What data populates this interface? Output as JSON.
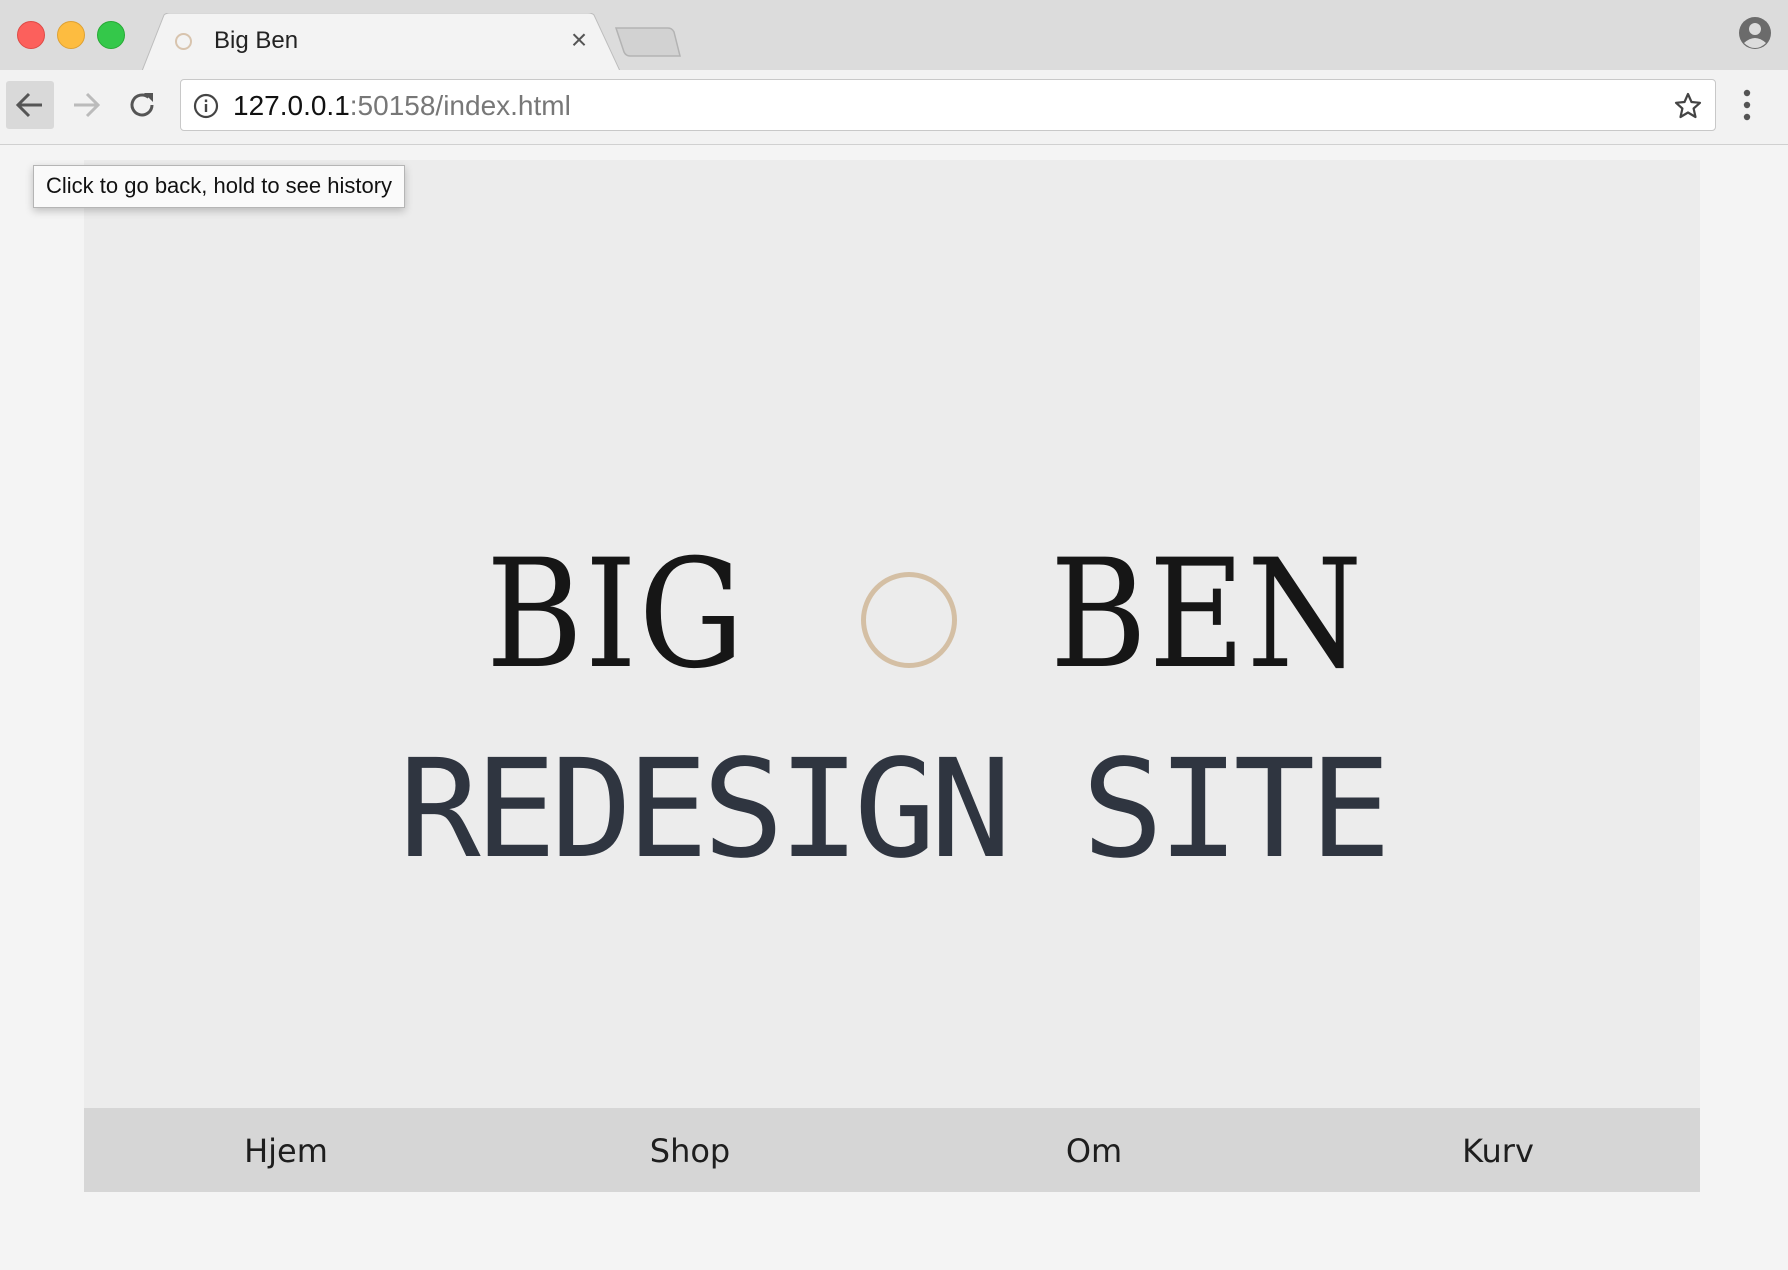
{
  "browser": {
    "tab_title": "Big Ben",
    "tab_close": "×",
    "url_host": "127.0.0.1",
    "url_rest": ":50158/index.html",
    "tooltip": "Click to go back, hold to see history",
    "icons": {
      "back": "arrow-left-icon",
      "forward": "arrow-right-icon",
      "reload": "reload-icon",
      "info": "info-icon",
      "star": "star-icon",
      "menu": "vertical-dots-icon",
      "profile": "profile-icon"
    }
  },
  "hero": {
    "brand_left": "BIG",
    "brand_right": "BEN",
    "subtitle": "REDESIGN SITE",
    "ring_color": "#d4bfa4"
  },
  "nav": {
    "items": [
      "Hjem",
      "Shop",
      "Om",
      "Kurv"
    ]
  }
}
